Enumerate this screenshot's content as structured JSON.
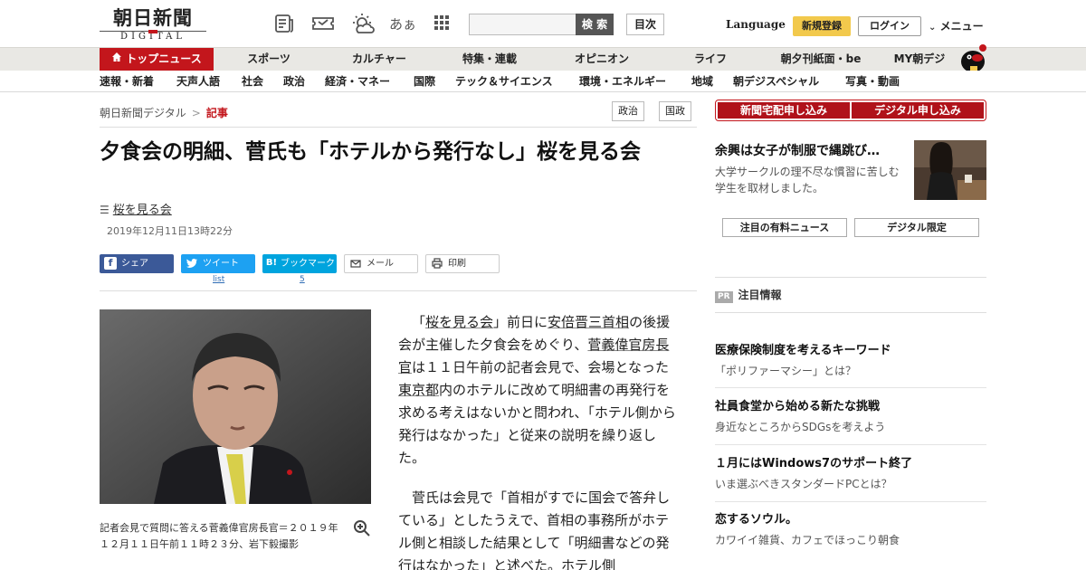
{
  "header": {
    "logo_jp": "朝日新聞",
    "logo_en": "DIGITAL",
    "icons": [
      "newspaper-icon",
      "ticket-icon",
      "weather-icon",
      "font-size-icon",
      "apps-grid-icon"
    ],
    "font_icon_text": "あぁ",
    "search_placeholder": "",
    "search_label": "検 索",
    "toc_label": "目次",
    "language_label": "Language",
    "register_label": "新規登録",
    "login_label": "ログイン",
    "menu_label": "メニュー"
  },
  "nav_primary": [
    {
      "label": "トップニュース",
      "active": true
    },
    {
      "label": "スポーツ"
    },
    {
      "label": "カルチャー"
    },
    {
      "label": "特集・連載"
    },
    {
      "label": "オピニオン"
    },
    {
      "label": "ライフ"
    },
    {
      "label": "朝夕刊紙面・be"
    },
    {
      "label": "MY朝デジ"
    }
  ],
  "nav_secondary": [
    "速報・新着",
    "天声人語",
    "社会",
    "政治",
    "経済・マネー",
    "国際",
    "テック＆サイエンス",
    "環境・エネルギー",
    "地域",
    "朝デジスペシャル",
    "写真・動画"
  ],
  "breadcrumb": {
    "home": "朝日新聞デジタル",
    "separator": ">",
    "current": "記事"
  },
  "tags": [
    "政治",
    "国政"
  ],
  "article": {
    "headline": "夕食会の明細、菅氏も「ホテルから発行なし」桜を見る会",
    "series_label": "桜を見る会",
    "date": "2019年12月11日13時22分",
    "share": {
      "facebook": "シェア",
      "twitter": "ツイート",
      "hatena_glyph": "B!",
      "hatena": "ブックマーク",
      "mail": "メール",
      "print": "印刷",
      "twitter_count": "list",
      "hatena_count": "5"
    },
    "photo_caption": "記者会見で質問に答える菅義偉官房長官＝２０１９年１２月１１日午前１１時２３分、岩下毅撮影",
    "p1": {
      "s1": "「",
      "l1": "桜を見る会",
      "s2": "」前日に",
      "l2": "安倍晋三首相",
      "s3": "の後援会が主催した夕食会をめぐり、",
      "l3": "菅義偉官房長官",
      "s4": "は１１日午前の記者会見で、会場となった",
      "l4": "東京都",
      "s5": "内のホテルに改めて明細書の再発行を求める考えはないかと問われ、「ホテル側から発行はなかった」と従来の説明を繰り返した。"
    },
    "p2": "菅氏は会見で「首相がすでに国会で答弁している」としたうえで、首相の事務所がホテル側と相談した結果として「明細書などの発行はなかった」と述べた。ホテル側"
  },
  "sidebar": {
    "subscribe_paper": "新聞宅配申し込み",
    "subscribe_digital": "デジタル申し込み",
    "promo_title": "余興は女子が制服で縄跳び…",
    "promo_desc": "大学サークルの理不尽な慣習に苦しむ学生を取材しました。",
    "btn_paid_news": "注目の有料ニュース",
    "btn_digital_only": "デジタル限定",
    "pr_badge": "PR",
    "pr_heading": "注目情報",
    "pr_items": [
      {
        "title": "医療保険制度を考えるキーワード",
        "sub": "「ポリファーマシー」とは？"
      },
      {
        "title": "社員食堂から始める新たな挑戦",
        "sub": "身近なところからSDGsを考えよう"
      },
      {
        "title": "１月にはWindows7のサポート終了",
        "sub": "いま選ぶべきスタンダードPCとは？"
      },
      {
        "title": "恋するソウル。",
        "sub": "カワイイ雑貨、カフェでほっこり朝食"
      }
    ]
  },
  "colors": {
    "brand_red": "#c3161c",
    "nav_bg": "#e9e8e4",
    "facebook": "#3b5998",
    "twitter": "#1da1f2",
    "hatena": "#00a4de",
    "register": "#f2c94c"
  }
}
